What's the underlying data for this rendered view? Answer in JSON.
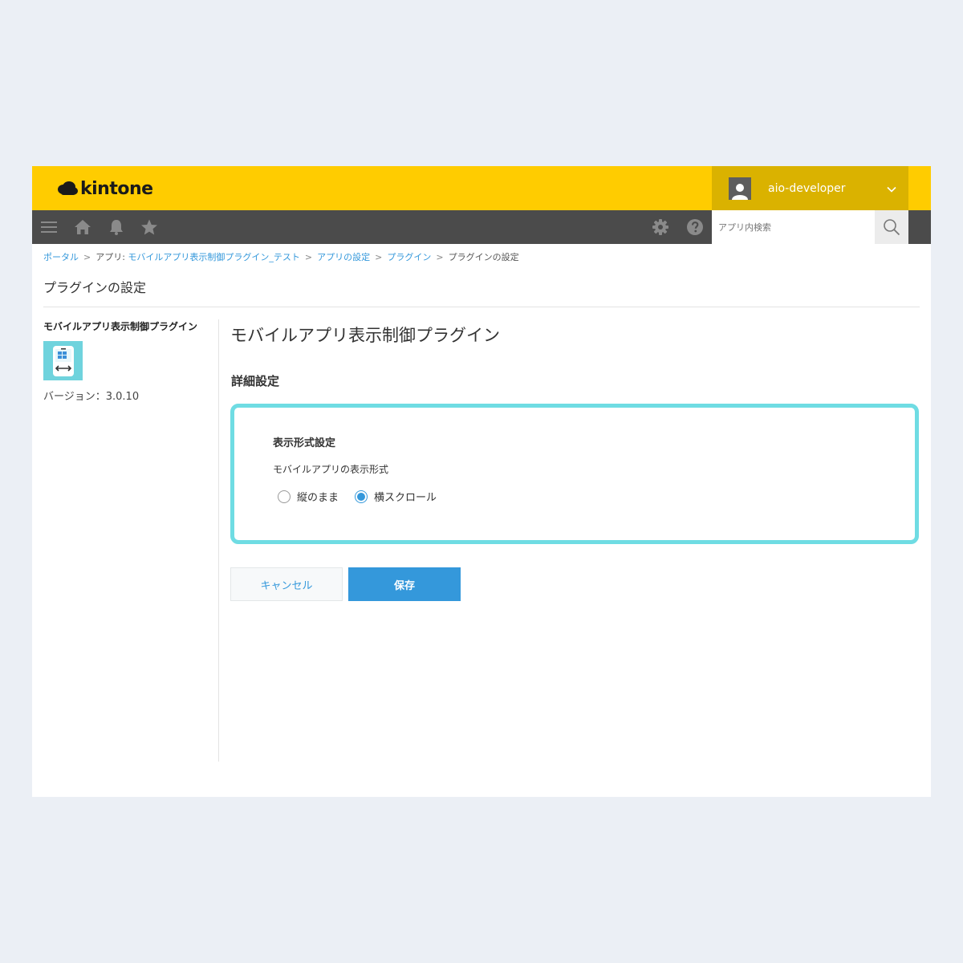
{
  "header": {
    "logo_text": "kintone",
    "user_name": "aio-developer"
  },
  "toolbar": {
    "left_icons": [
      "menu-icon",
      "home-icon",
      "bell-icon",
      "star-icon"
    ],
    "right_icons": [
      "gear-icon",
      "help-icon"
    ],
    "search_placeholder": "アプリ内検索"
  },
  "breadcrumb": {
    "items": [
      "ポータル",
      "アプリ: モバイルアプリ表示制御プラグイン_テスト",
      "アプリの設定",
      "プラグイン",
      "プラグインの設定"
    ],
    "separator": ">"
  },
  "page": {
    "title": "プラグインの設定"
  },
  "sidebar": {
    "plugin_name": "モバイルアプリ表示制御プラグイン",
    "plugin_icon": "mobile-scroll-icon",
    "version_label": "バージョン：3.0.10"
  },
  "main": {
    "title": "モバイルアプリ表示制御プラグイン",
    "section_title": "詳細設定",
    "panel": {
      "heading": "表示形式設定",
      "label": "モバイルアプリの表示形式",
      "options": [
        {
          "label": "縦のまま",
          "checked": false
        },
        {
          "label": "横スクロール",
          "checked": true
        }
      ]
    },
    "cancel_label": "キャンセル",
    "save_label": "保存"
  },
  "colors": {
    "header_bg": "#ffcc00",
    "user_box_bg": "#dab200",
    "toolbar_bg": "#4b4b4b",
    "accent": "#3498db",
    "panel_border": "#6fdce3",
    "page_bg": "#ebeff5"
  }
}
